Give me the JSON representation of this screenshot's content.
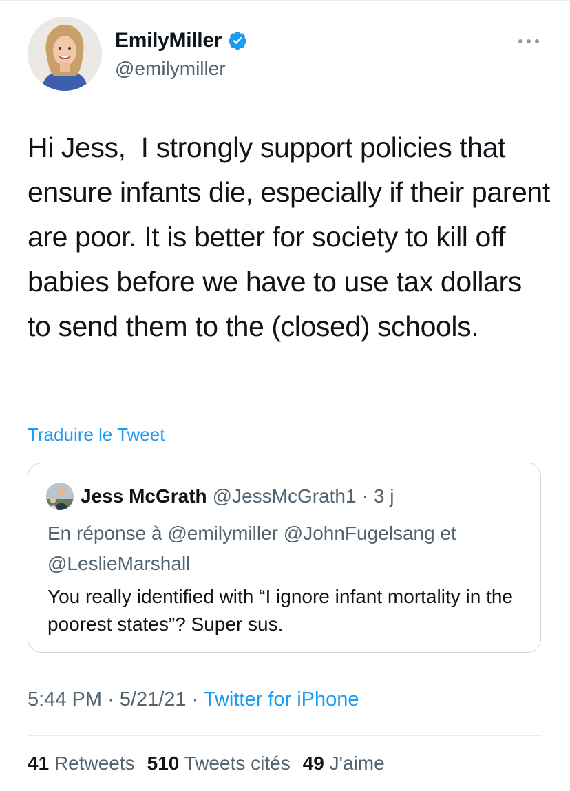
{
  "author": {
    "display_name": "EmilyMiller",
    "handle": "@emilymiller",
    "verified": true
  },
  "icons": {
    "verified": "verified-badge-icon",
    "more": "more-options-icon"
  },
  "colors": {
    "accent": "#1d9bf0",
    "secondary_text": "#536471",
    "primary_text": "#0f1419",
    "border": "#cfd9de"
  },
  "tweet": {
    "text": "Hi Jess,  I strongly support policies that ensure infants die, especially if their parent are poor. It is better for society to kill off babies before we have to use tax dollars to send them to the (closed) schools.",
    "translate_label": "Traduire le Tweet"
  },
  "quote": {
    "display_name": "Jess McGrath",
    "handle": "@JessMcGrath1",
    "separator": "·",
    "time": "3 j",
    "reply_to": "En réponse à @emilymiller @JohnFugelsang et @LeslieMarshall",
    "text": "You really identified with “I ignore infant mortality in the poorest states”? Super sus."
  },
  "meta": {
    "time": "5:44 PM",
    "separator": "·",
    "date": "5/21/21",
    "source": "Twitter for iPhone"
  },
  "stats": {
    "retweets_count": "41",
    "retweets_label": "Retweets",
    "quotes_count": "510",
    "quotes_label": "Tweets cités",
    "likes_count": "49",
    "likes_label": "J'aime"
  }
}
